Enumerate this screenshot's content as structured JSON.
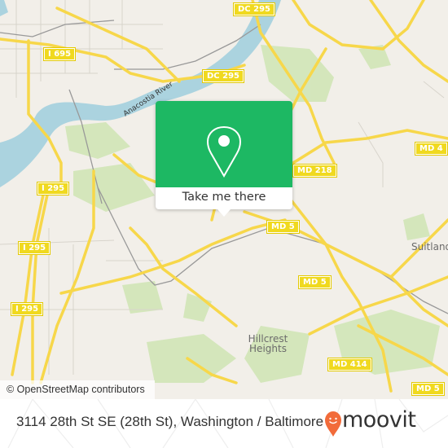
{
  "map": {
    "road_shields": [
      {
        "id": "i695",
        "label": "I 695"
      },
      {
        "id": "dc295-top",
        "label": "DC 295"
      },
      {
        "id": "dc295-mid",
        "label": "DC 295"
      },
      {
        "id": "md4",
        "label": "MD 4"
      },
      {
        "id": "md218",
        "label": "MD 218"
      },
      {
        "id": "i295-a",
        "label": "I 295"
      },
      {
        "id": "i295-b",
        "label": "I 295"
      },
      {
        "id": "i295-c",
        "label": "I 295"
      },
      {
        "id": "md5-a",
        "label": "MD 5"
      },
      {
        "id": "md5-b",
        "label": "MD 5"
      },
      {
        "id": "md5-c",
        "label": "MD 5"
      },
      {
        "id": "md414",
        "label": "MD 414"
      }
    ],
    "place_labels": {
      "suitland": "Suitland",
      "hillcrest_line1": "Hillcrest",
      "hillcrest_line2": "Heights"
    },
    "water_labels": {
      "anacostia": "Anacostia River"
    },
    "attribution": "© OpenStreetMap contributors"
  },
  "popup": {
    "icon": "map-pin-icon",
    "button_label": "Take me there",
    "color": "#1db863"
  },
  "footer": {
    "address": "3114 28th St SE (28th St), Washington / Baltimore",
    "brand": "moovit",
    "brand_color": "#f26b3a"
  }
}
